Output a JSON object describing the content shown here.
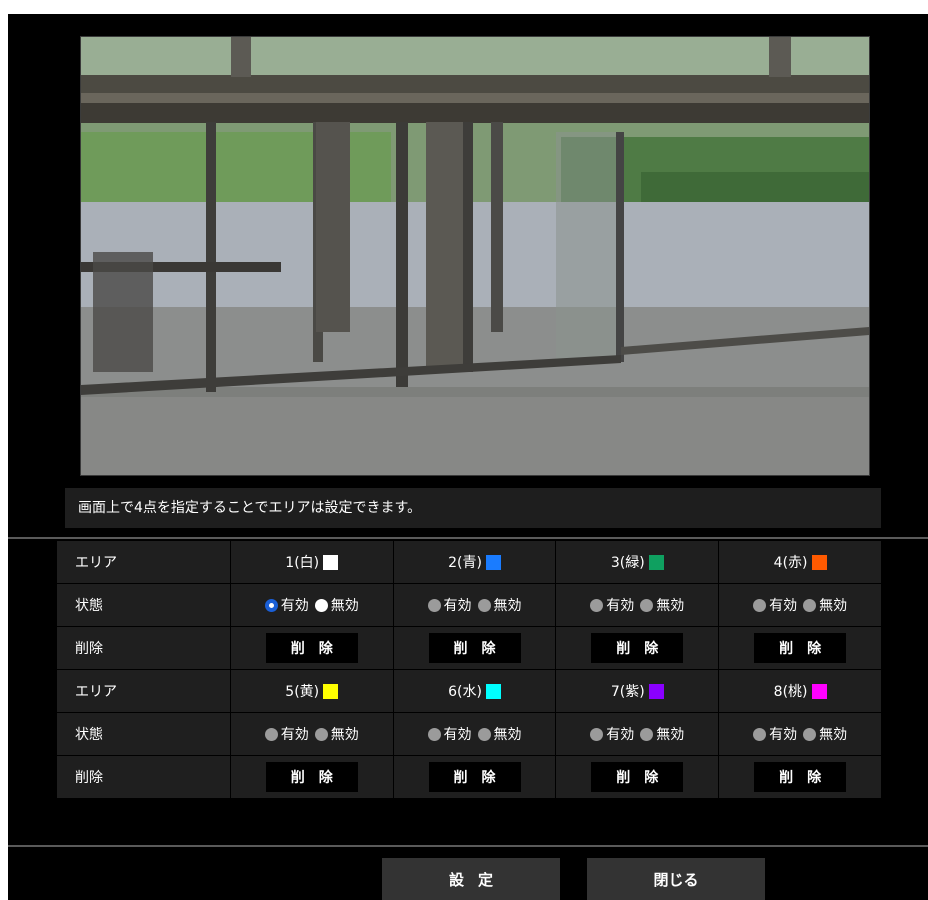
{
  "hint": {
    "text": "画面上で4点を指定することでエリアは設定できます。"
  },
  "labels": {
    "area": "エリア",
    "status": "状態",
    "delete": "削除"
  },
  "radio": {
    "enabled": "有効",
    "disabled": "無効"
  },
  "delete_button": "削除",
  "areas": [
    {
      "label": "1(白)",
      "color": "#ffffff",
      "enabled_state": "selected"
    },
    {
      "label": "2(青)",
      "color": "#1a7cff",
      "enabled_state": "none"
    },
    {
      "label": "3(緑)",
      "color": "#0fa060",
      "enabled_state": "none"
    },
    {
      "label": "4(赤)",
      "color": "#ff5a00",
      "enabled_state": "none"
    },
    {
      "label": "5(黄)",
      "color": "#ffff00",
      "enabled_state": "none"
    },
    {
      "label": "6(水)",
      "color": "#00ffff",
      "enabled_state": "none"
    },
    {
      "label": "7(紫)",
      "color": "#8a00ff",
      "enabled_state": "none"
    },
    {
      "label": "8(桃)",
      "color": "#ff00ff",
      "enabled_state": "none"
    }
  ],
  "buttons": {
    "set": "設定",
    "close": "閉じる"
  }
}
